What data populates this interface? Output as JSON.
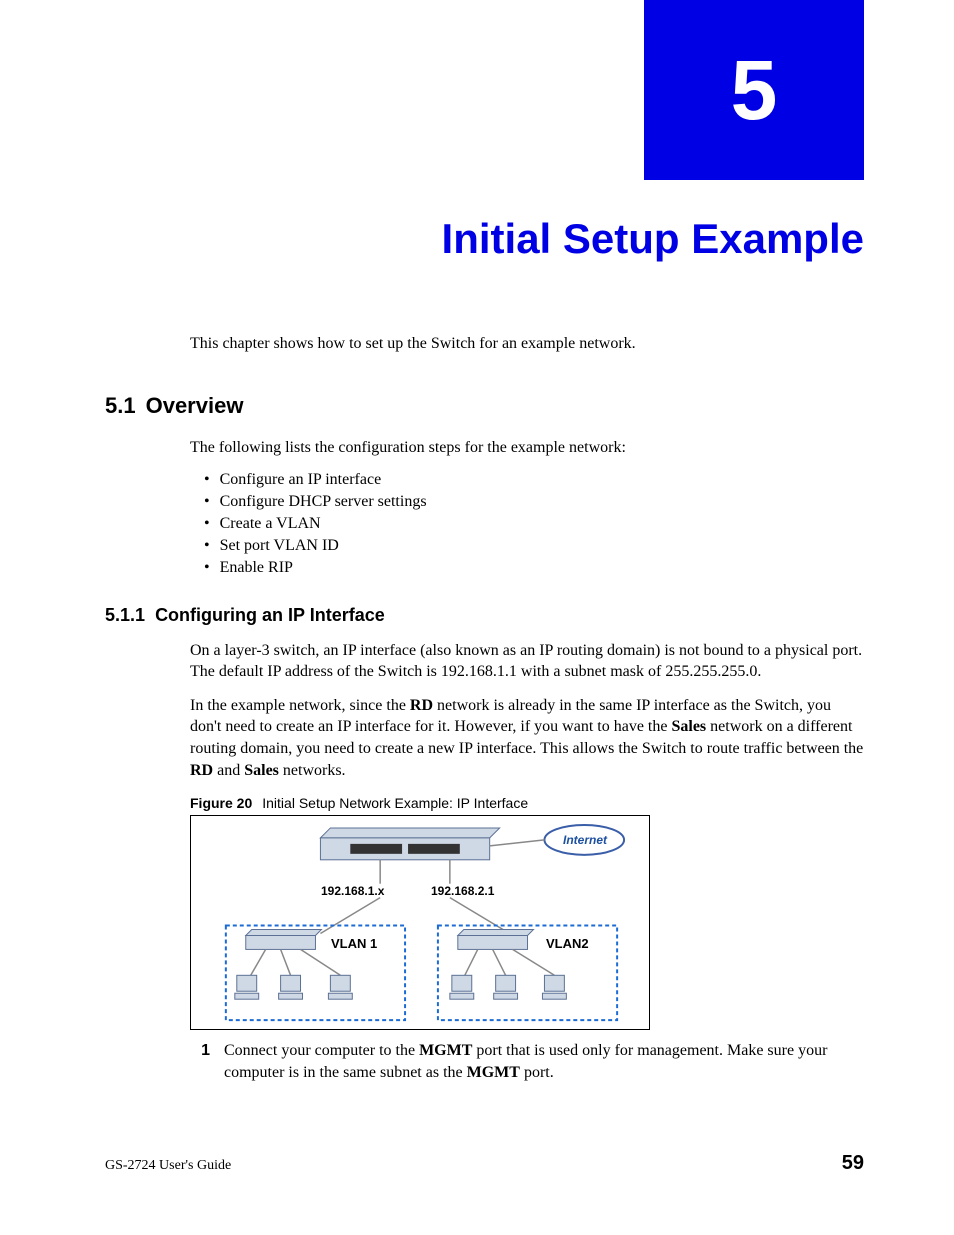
{
  "chapter": {
    "number": "5",
    "title": "Initial Setup Example"
  },
  "intro": "This chapter shows how to set up the Switch for an example network.",
  "section51": {
    "num": "5.1",
    "title": "Overview",
    "lead": "The following lists the configuration steps for the example network:",
    "bullets": [
      "Configure an IP interface",
      "Configure DHCP server settings",
      "Create a VLAN",
      "Set port VLAN ID",
      "Enable RIP"
    ]
  },
  "section511": {
    "num": "5.1.1",
    "title": "Configuring an IP Interface",
    "p1": "On a layer-3 switch, an IP interface (also known as an IP routing domain) is not bound to a physical port. The default IP address of the Switch is 192.168.1.1 with a subnet mask of 255.255.255.0.",
    "p2a": "In the example network, since the ",
    "p2b": " network is already in the same IP interface as the Switch, you don't need to create an IP interface for it. However, if you want to have the ",
    "p2c": " network on a different routing domain, you need to create a new IP interface. This allows the Switch to route traffic between the ",
    "p2d": " and ",
    "p2e": " networks.",
    "rd": "RD",
    "sales": "Sales"
  },
  "figure": {
    "label": "Figure 20",
    "caption": "Initial Setup Network Example: IP Interface",
    "internet": "Internet",
    "ip1": "192.168.1.x",
    "ip2": "192.168.2.1",
    "vlan1": "VLAN 1",
    "vlan2": "VLAN2"
  },
  "step1a": "Connect your computer to the ",
  "step1b": " port that is used only for management. Make sure your computer is in the same subnet as the ",
  "step1c": " port.",
  "mgmt": "MGMT",
  "footer": {
    "left": "GS-2724 User's Guide",
    "page": "59"
  }
}
